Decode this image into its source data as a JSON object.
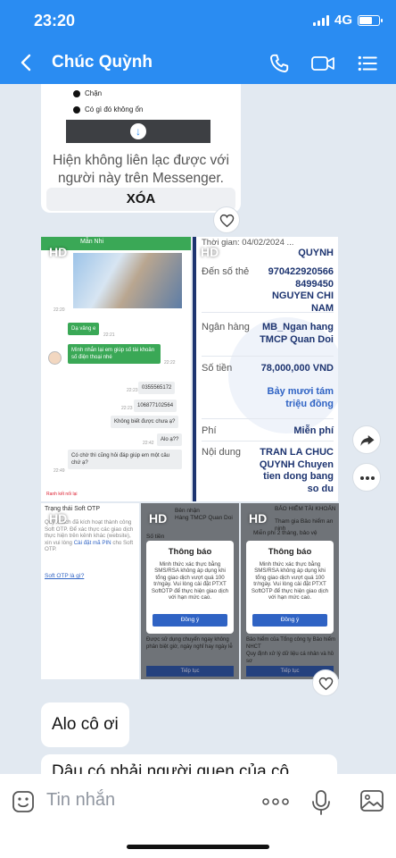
{
  "status_bar": {
    "time": "23:20",
    "network": "4G",
    "battery_level": 0.65
  },
  "header": {
    "contact_name": "Chúc Quỳnh",
    "back_icon": "chevron-left-icon",
    "icons": [
      "phone-icon",
      "video-icon",
      "list-icon"
    ]
  },
  "messenger_card": {
    "row_block": "Chặn",
    "row_other": "Có gì đó không ổn",
    "notice": "Hiện không liên lạc được với người này trên Messenger.",
    "delete_label": "XÓA"
  },
  "hd_label": "HD",
  "chat_image": {
    "header_name": "Mẫn Nhi",
    "timestamps": [
      "22:20",
      "22:21",
      "22:22",
      "22:23",
      "22:23",
      "22:24",
      "22:42",
      "22:49"
    ],
    "messages": [
      "Dạ vâng e",
      "Mình nhắn lại em giúp số tài khoản số điện thoại nhé",
      "0355565172",
      "106877102564",
      "Không biết được chưa ạ?",
      "Alo ạ??",
      "Có chờ thì cũng hỏi đáp giúp em một câu chứ ạ?"
    ],
    "footer": "Ranh kết nối lại"
  },
  "transfer_image": {
    "time": "Thời gian: 04/02/2024 ...",
    "top_name": "QUYNH",
    "to_account_label": "Đến số thẻ",
    "to_account_value": "970422920566 8499450 NGUYEN CHI NAM",
    "bank_label": "Ngân hàng",
    "bank_value": "MB_Ngan hang TMCP Quan Doi",
    "amount_label": "Số tiền",
    "amount_value": "78,000,000 VND",
    "amount_words": "Bảy mươi tám triệu đồng",
    "fee_label": "Phí",
    "fee_value": "Miễn phí",
    "content_label": "Nội dung",
    "content_value": "TRAN LA CHUC QUYNH Chuyen tien dong bang so du"
  },
  "otp_image": {
    "title": "Trạng thái Soft OTP",
    "body_start": "Quý khách đã kích hoạt thành công Soft OTP. Để xác thực các giao dịch thực hiện trên kênh khác (website), xin vui lòng ",
    "body_link": "Cài đặt mã PIN",
    "body_end": " cho Soft OTP.",
    "question": "Soft OTP là gì?"
  },
  "dialog_image_1": {
    "top": "Bên nhận\nHàng TMCP Quan Doi",
    "subtop": "Số tiền",
    "dialog_title": "Thông báo",
    "dialog_message": "Minh thức xác thực bằng SMS/RSA không áp dụng khi tổng giao dịch vượt quá 100 tr/ngày. Vui lòng cài đặt PTXT SoftOTP để thực hiện giao dịch với hạn mức cao.",
    "dialog_button": "Đồng ý",
    "bottom": "Được sử dụng chuyển ngay không phân biệt giờ, ngày nghỉ hay ngày lễ",
    "bottom_button": "Tiếp tục"
  },
  "dialog_image_2": {
    "top": "BẢO HIỂM TÀI KHOẢN",
    "top2": "Tham gia Bảo hiểm an ninh",
    "top3": "Miễn phí 2 tháng, bảo vệ",
    "dialog_title": "Thông báo",
    "dialog_message": "Minh thức xác thực bằng SMS/RSA không áp dụng khi tổng giao dịch vượt quá 100 tr/ngày. Vui lòng cài đặt PTXT SoftOTP để thực hiện giao dịch với hạn mức cao.",
    "dialog_button": "Đồng ý",
    "bottom": "Bảo hiểm của Tổng công ty Bảo hiểm NHCT",
    "bottom2": "Quy định xử lý dữ liệu cá nhân và hồ sơ",
    "bottom_button": "Tiếp tục"
  },
  "messages": [
    {
      "text": "Alo cô ơi"
    },
    {
      "text": "Dậu có phải người quen của cô"
    }
  ],
  "input": {
    "placeholder": "Tin nhắn"
  }
}
